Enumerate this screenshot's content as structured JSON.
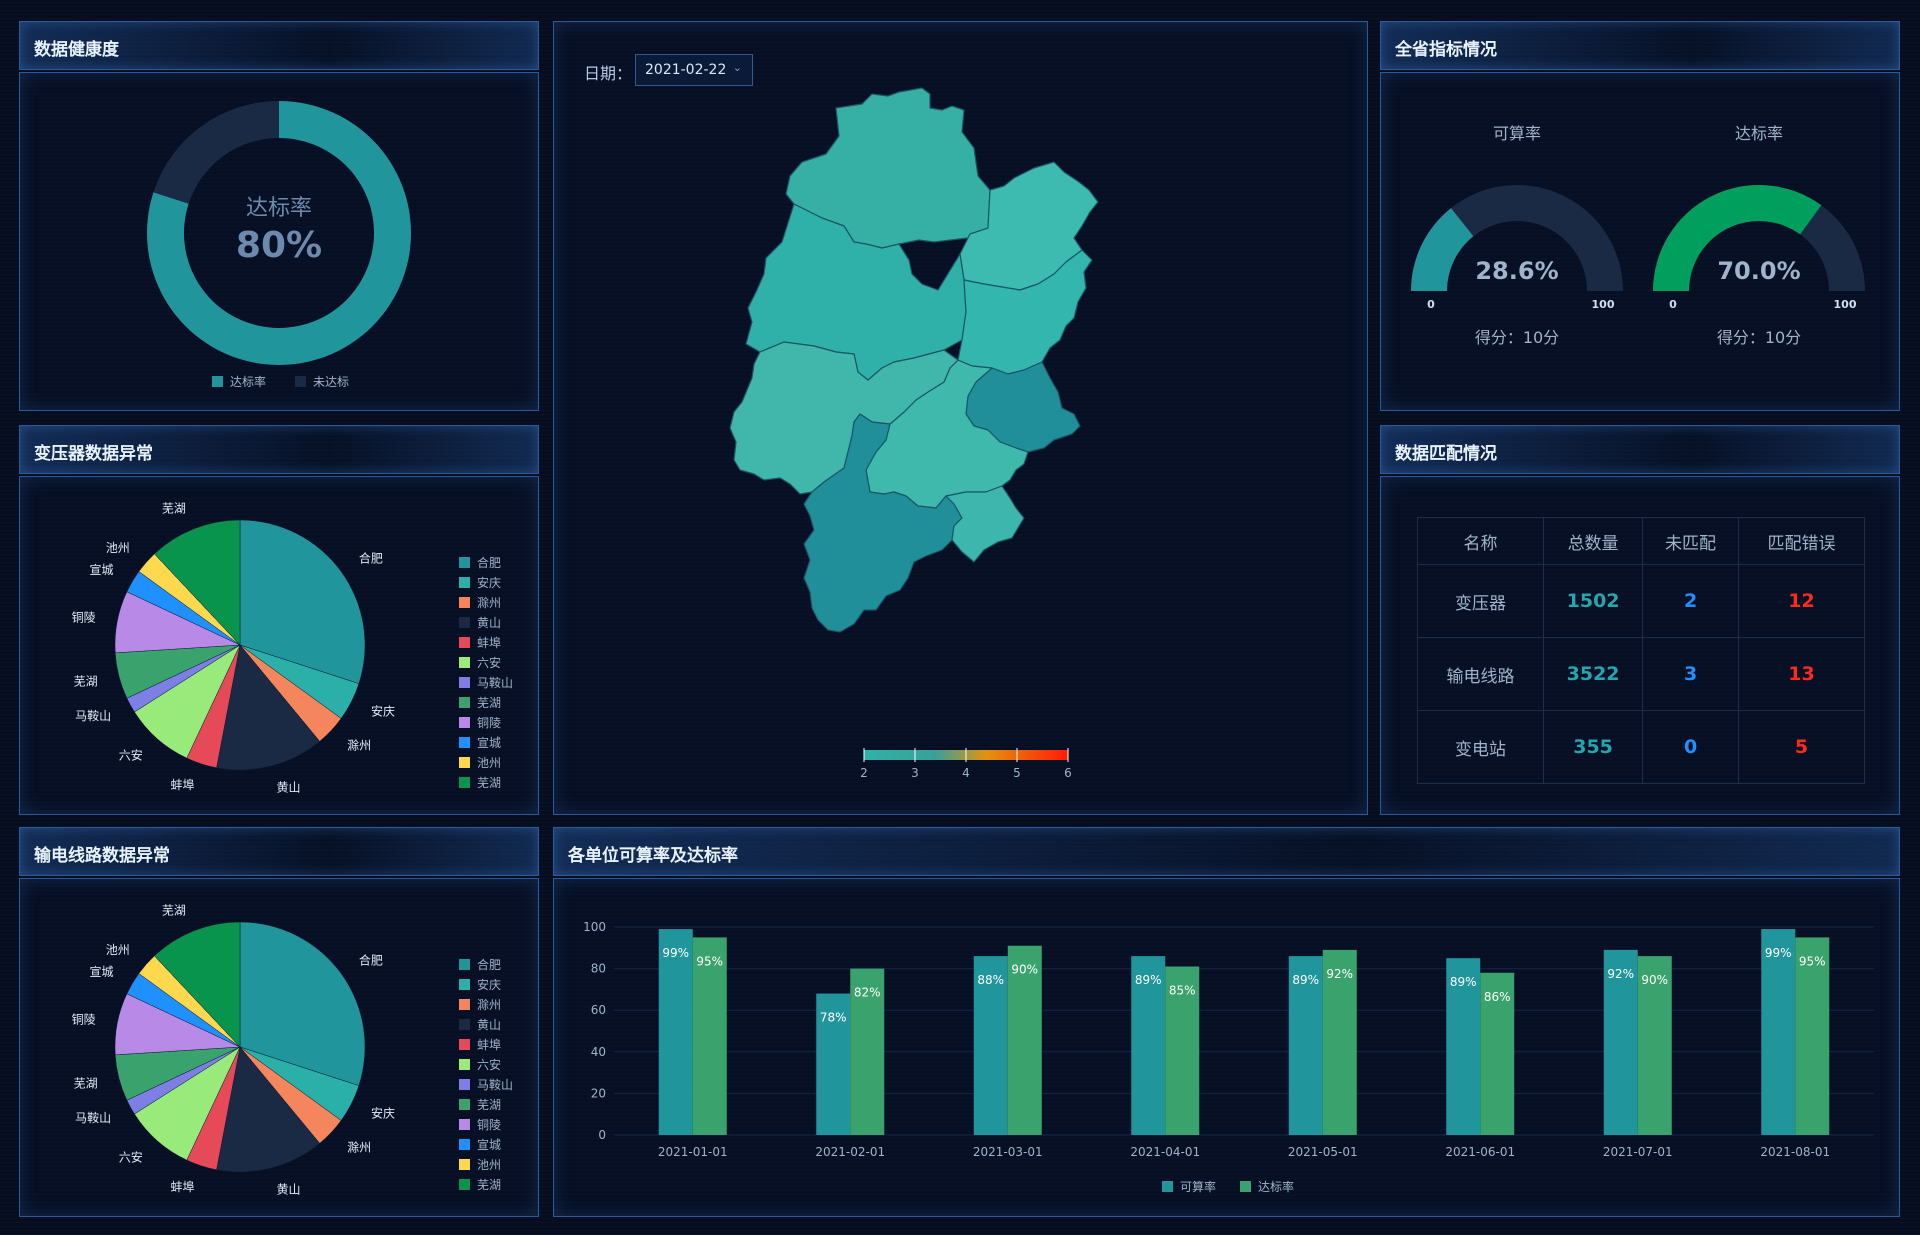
{
  "panels": {
    "health": "数据健康度",
    "transformer": "变压器数据异常",
    "line": "输电线路数据异常",
    "province": "全省指标情况",
    "match": "数据匹配情况",
    "units": "各单位可算率及达标率"
  },
  "date_filter": {
    "label": "日期：",
    "value": "2021-02-22"
  },
  "map_scale": {
    "ticks": [
      "2",
      "3",
      "4",
      "5",
      "6"
    ]
  },
  "colors": {
    "teal": "#21959c",
    "green": "#3aa36d",
    "dark": "#1a2a45",
    "gaugeGreen": "#009f5e",
    "blue": "#1e90ff",
    "red": "#ff2a1a"
  },
  "chart_data": [
    {
      "type": "pie",
      "name": "donut",
      "center_label": "达标率",
      "center_value": "80%",
      "slices": [
        {
          "label": "达标率",
          "value": 80,
          "color": "#21959c"
        },
        {
          "label": "未达标",
          "value": 20,
          "color": "#1a2a45"
        }
      ]
    },
    {
      "type": "pie",
      "name": "transformer-pie",
      "slices": [
        {
          "label": "合肥",
          "value": 30,
          "color": "#21959c"
        },
        {
          "label": "安庆",
          "value": 5,
          "color": "#2ab0a8"
        },
        {
          "label": "滁州",
          "value": 4,
          "color": "#f4855d"
        },
        {
          "label": "黄山",
          "value": 14,
          "color": "#1a2a45"
        },
        {
          "label": "蚌埠",
          "value": 4,
          "color": "#e64a59"
        },
        {
          "label": "六安",
          "value": 9,
          "color": "#98ea7a"
        },
        {
          "label": "马鞍山",
          "value": 2,
          "color": "#7d7fe4"
        },
        {
          "label": "芜湖",
          "value": 6,
          "color": "#3aa36d"
        },
        {
          "label": "铜陵",
          "value": 8,
          "color": "#b889e6"
        },
        {
          "label": "宣城",
          "value": 3,
          "color": "#1e90ff"
        },
        {
          "label": "池州",
          "value": 3,
          "color": "#ffd84d"
        },
        {
          "label": "芜湖",
          "value": 12,
          "color": "#08944d"
        }
      ]
    },
    {
      "type": "pie",
      "name": "line-pie",
      "slices": [
        {
          "label": "合肥",
          "value": 30,
          "color": "#21959c"
        },
        {
          "label": "安庆",
          "value": 5,
          "color": "#2ab0a8"
        },
        {
          "label": "滁州",
          "value": 4,
          "color": "#f4855d"
        },
        {
          "label": "黄山",
          "value": 14,
          "color": "#1a2a45"
        },
        {
          "label": "蚌埠",
          "value": 4,
          "color": "#e64a59"
        },
        {
          "label": "六安",
          "value": 9,
          "color": "#98ea7a"
        },
        {
          "label": "马鞍山",
          "value": 2,
          "color": "#7d7fe4"
        },
        {
          "label": "芜湖",
          "value": 6,
          "color": "#3aa36d"
        },
        {
          "label": "铜陵",
          "value": 8,
          "color": "#b889e6"
        },
        {
          "label": "宣城",
          "value": 3,
          "color": "#1e90ff"
        },
        {
          "label": "池州",
          "value": 3,
          "color": "#ffd84d"
        },
        {
          "label": "芜湖",
          "value": 12,
          "color": "#08944d"
        }
      ]
    },
    {
      "type": "gauge",
      "name": "gauges",
      "gauges": [
        {
          "title": "可算率",
          "value": 28.6,
          "display": "28.6%",
          "min": "0",
          "max": "100",
          "score": "得分：10分",
          "color": "#21959c"
        },
        {
          "title": "达标率",
          "value": 70.0,
          "display": "70.0%",
          "min": "0",
          "max": "100",
          "score": "得分：10分",
          "color": "#009f5e"
        }
      ]
    },
    {
      "type": "table",
      "name": "match-table",
      "columns": [
        "名称",
        "总数量",
        "未匹配",
        "匹配错误"
      ],
      "rows": [
        [
          "变压器",
          "1502",
          "2",
          "12"
        ],
        [
          "输电线路",
          "3522",
          "3",
          "13"
        ],
        [
          "变电站",
          "355",
          "0",
          "5"
        ]
      ]
    },
    {
      "type": "bar",
      "name": "units-bar",
      "categories": [
        "2021-01-01",
        "2021-02-01",
        "2021-03-01",
        "2021-04-01",
        "2021-05-01",
        "2021-06-01",
        "2021-07-01",
        "2021-08-01"
      ],
      "series": [
        {
          "name": "可算率",
          "values": [
            99,
            68,
            86,
            86,
            86,
            85,
            89,
            99
          ],
          "labels": [
            "99%",
            "78%",
            "88%",
            "89%",
            "89%",
            "89%",
            "92%",
            "99%"
          ],
          "color": "#21959c"
        },
        {
          "name": "达标率",
          "values": [
            95,
            80,
            91,
            81,
            89,
            78,
            86,
            95
          ],
          "labels": [
            "95%",
            "82%",
            "90%",
            "85%",
            "92%",
            "86%",
            "90%",
            "95%"
          ],
          "color": "#3aa36d"
        }
      ],
      "ylim": [
        0,
        100
      ],
      "yticks": [
        "0",
        "20",
        "40",
        "60",
        "80",
        "100"
      ]
    }
  ]
}
